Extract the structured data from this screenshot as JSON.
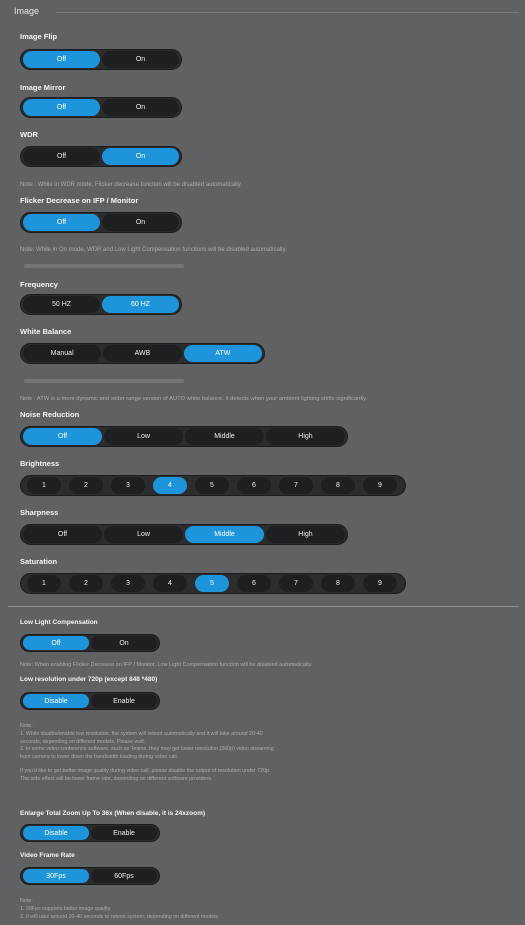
{
  "section": {
    "legend": "Image"
  },
  "image_flip": {
    "label": "Image Flip",
    "options": [
      "Off",
      "On"
    ],
    "selected": "Off"
  },
  "image_mirror": {
    "label": "Image Mirror",
    "options": [
      "Off",
      "On"
    ],
    "selected": "Off"
  },
  "wdr": {
    "label": "WDR",
    "options": [
      "Off",
      "On"
    ],
    "selected": "On",
    "note": "Note : While in WDR mode, Flicker decrease function will be disabled automatically."
  },
  "flicker": {
    "label": "Flicker Decrease on IFP / Monitor",
    "options": [
      "Off",
      "On"
    ],
    "selected": "Off",
    "note": "Note: While in On mode, WDR and Low Light Compensation functions will be disabled automatically."
  },
  "frequency": {
    "label": "Frequency",
    "options": [
      "50 HZ",
      "60 HZ"
    ],
    "selected": "60 HZ"
  },
  "white_balance": {
    "label": "White Balance",
    "options": [
      "Manual",
      "AWB",
      "ATW"
    ],
    "selected": "ATW",
    "note": "Note : ATW is a more dynamic and wider range version of AUTO white balance. It detects when your ambient lighting shifts significantly."
  },
  "noise_reduction": {
    "label": "Noise Reduction",
    "options": [
      "Off",
      "Low",
      "Middle",
      "High"
    ],
    "selected": "Off"
  },
  "brightness": {
    "label": "Brightness",
    "options": [
      "1",
      "2",
      "3",
      "4",
      "5",
      "6",
      "7",
      "8",
      "9"
    ],
    "selected": "4"
  },
  "sharpness": {
    "label": "Sharpness",
    "options": [
      "Off",
      "Low",
      "Middle",
      "High"
    ],
    "selected": "Middle"
  },
  "saturation": {
    "label": "Saturation",
    "options": [
      "1",
      "2",
      "3",
      "4",
      "5",
      "6",
      "7",
      "8",
      "9"
    ],
    "selected": "5"
  },
  "low_light": {
    "label": "Low Light Compensation",
    "options": [
      "Off",
      "On"
    ],
    "selected": "Off",
    "note": "Note: When enabling Flicker Decrease on IFP / Monitor, Low Light Compensation function will be disabled automatically."
  },
  "low_res": {
    "label": "Low resolution under 720p (except 848 *480)",
    "options": [
      "Disable",
      "Enable"
    ],
    "selected": "Disable",
    "note_lines": [
      "Note:",
      "1. While disable/enable low resolution, the system will reboot automatically and it will take around 20-40",
      "seconds, depending on different models. Please wait.",
      "2. In some video conference software, such as Teams, they may get lower resolution (360p) video streaming",
      "from camera to lower down the bandwidth loading during video call.",
      "",
      "If you'd like to get better image quality during video call, please disable the output of resolution under 720p.",
      "The side effect will be lower frame rate, depending on different software providers."
    ]
  },
  "zoom": {
    "label": "Enlarge Total Zoom Up To 36x (When disable, it is 24xzoom)",
    "options": [
      "Disable",
      "Enable"
    ],
    "selected": "Disable"
  },
  "frame_rate": {
    "label": "Video Frame Rate",
    "options": [
      "30Fps",
      "60Fps"
    ],
    "selected": "30Fps",
    "note_lines": [
      "Note:",
      "1. 30Fps supports better image quality.",
      "2. It will take around 20-40 seconds to reboot system, depending on different models."
    ]
  }
}
